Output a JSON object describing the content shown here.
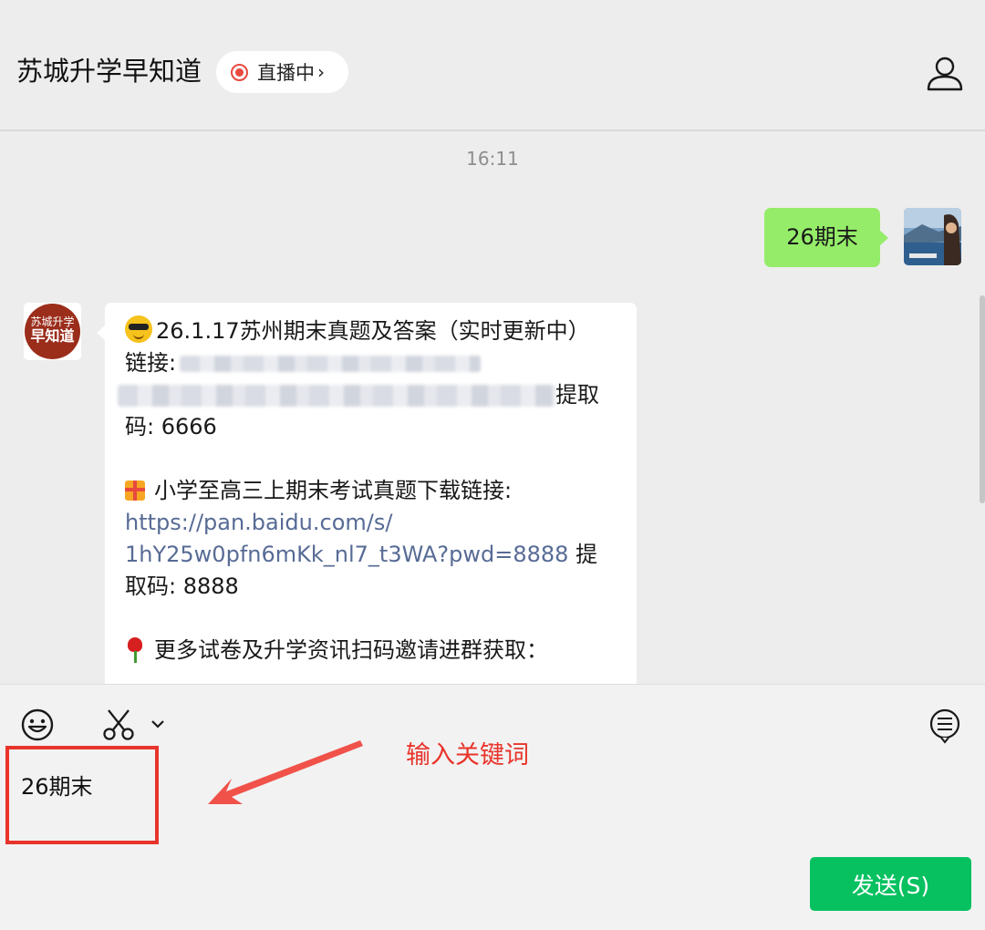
{
  "header": {
    "title": "苏城升学早知道",
    "live_label": "直播中",
    "live_chevron": "›"
  },
  "chat": {
    "timestamp": "16:11",
    "outgoing": {
      "text": "26期末"
    },
    "bot_avatar": {
      "line1": "苏城升学",
      "line2": "早知道"
    },
    "incoming": {
      "line1": "26.1.17苏州期末真题及答案（实时更新中）",
      "line2_label": "链接:",
      "line3_tail": "提取",
      "line4": "码: 6666",
      "line5": "小学至高三上期末考试真题下载链接:",
      "link_line1": "https://pan.baidu.com/s/",
      "link_line2": "1hY25w0pfn6mKk_nl7_t3WA?pwd=8888",
      "link_tail": " 提",
      "line8": "取码: 8888",
      "line9": "更多试卷及升学资讯扫码邀请进群获取："
    }
  },
  "composer": {
    "input_value": "26期末",
    "annotation": "输入关键词",
    "send_label": "发送(S)"
  },
  "colors": {
    "accent_green": "#07c160",
    "bubble_green": "#95ec69",
    "link_blue": "#576b95",
    "annotation_red": "#e8342b"
  },
  "icons": [
    "profile-icon",
    "emoji-icon",
    "scissors-icon",
    "chevron-down-icon",
    "chat-history-icon"
  ]
}
